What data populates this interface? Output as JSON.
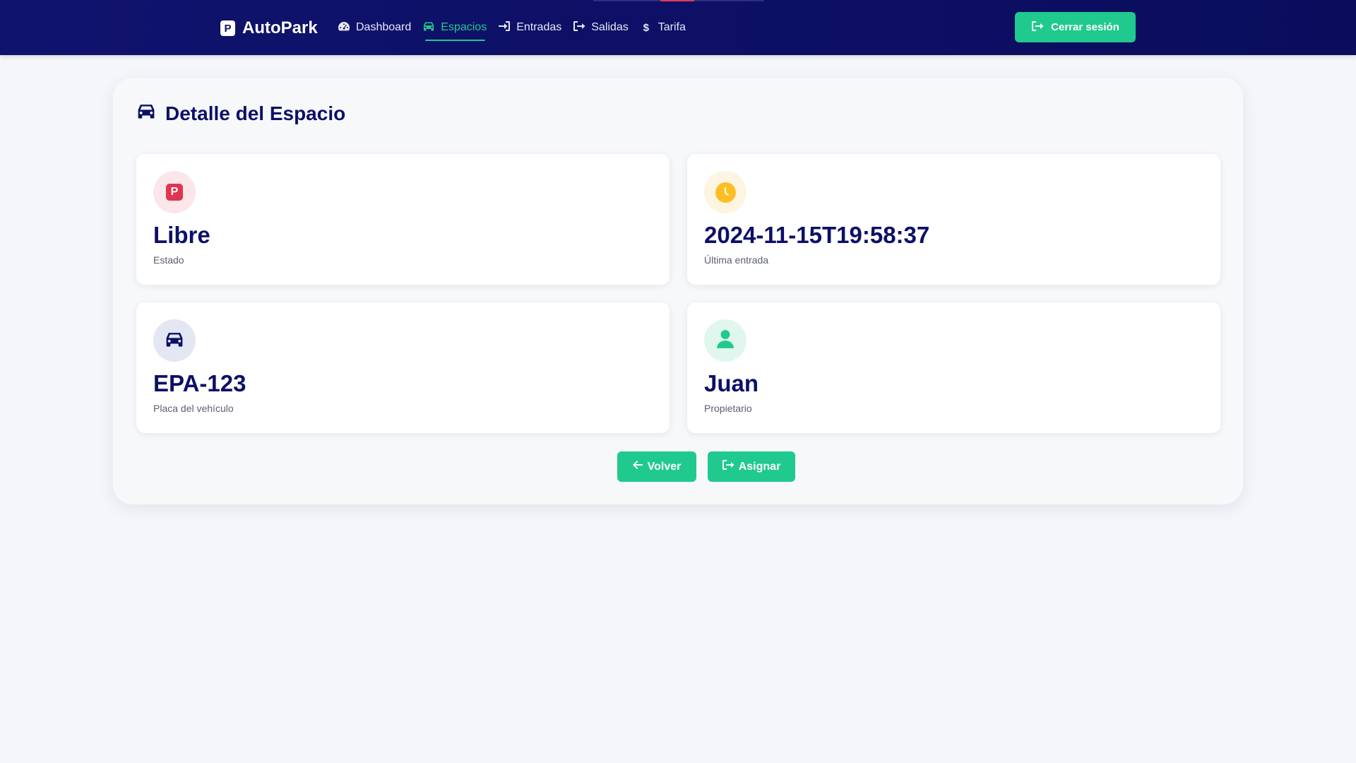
{
  "navbar": {
    "brand": "AutoPark",
    "brand_icon": "P",
    "links": [
      {
        "label": "Dashboard",
        "icon": "dashboard-icon",
        "active": false
      },
      {
        "label": "Espacios",
        "icon": "car-icon",
        "active": true
      },
      {
        "label": "Entradas",
        "icon": "sign-in-icon",
        "active": false
      },
      {
        "label": "Salidas",
        "icon": "sign-out-icon",
        "active": false
      },
      {
        "label": "Tarifa",
        "icon": "dollar-icon",
        "active": false
      }
    ],
    "logout_label": "Cerrar sesión",
    "logout_icon": "sign-out-icon"
  },
  "page": {
    "title": "Detalle del Espacio",
    "title_icon": "car-icon"
  },
  "cards": [
    {
      "value": "Libre",
      "label": "Estado",
      "icon": "parking-icon",
      "icon_color": "#e0354f"
    },
    {
      "value": "2024-11-15T19:58:37",
      "label": "Última entrada",
      "icon": "clock-icon",
      "icon_color": "#fbbf24"
    },
    {
      "value": "EPA-123",
      "label": "Placa del vehículo",
      "icon": "car-icon",
      "icon_color": "#0d1066"
    },
    {
      "value": "Juan",
      "label": "Propietario",
      "icon": "user-icon",
      "icon_color": "#20c98e"
    }
  ],
  "actions": {
    "back_label": "Volver",
    "assign_label": "Asignar"
  },
  "colors": {
    "navy": "#0d1066",
    "accent_green": "#20c98e",
    "background": "#f5f6f9"
  }
}
